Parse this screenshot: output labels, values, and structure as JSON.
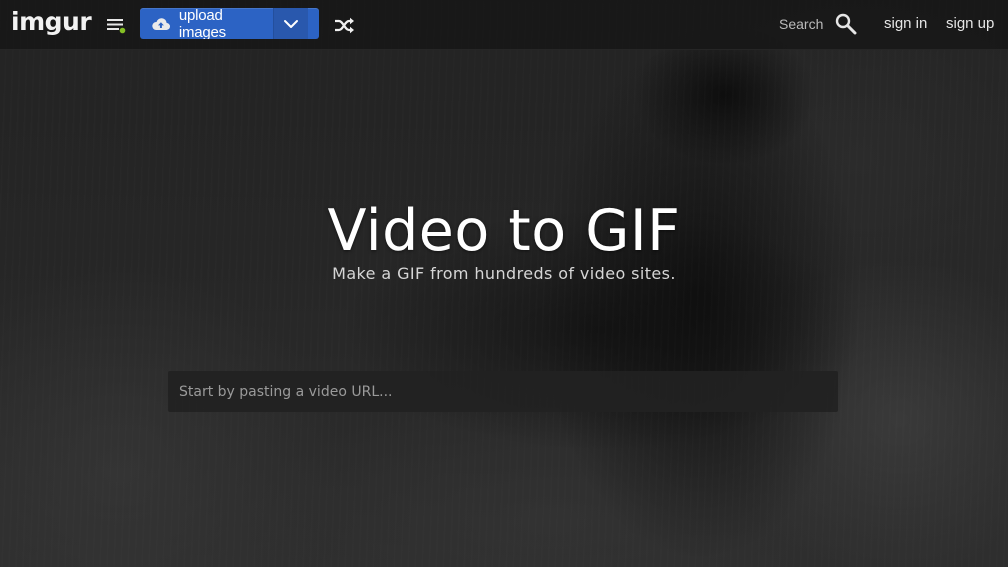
{
  "header": {
    "logo_text": "imgur",
    "upload_label": "upload images",
    "search_label": "Search",
    "sign_in": "sign in",
    "sign_up": "sign up"
  },
  "hero": {
    "title": "Video to GIF",
    "subtitle": "Make a GIF from hundreds of video sites.",
    "url_placeholder": "Start by pasting a video URL..."
  },
  "icons": {
    "menu": "menu-icon",
    "upload": "cloud-upload-icon",
    "dropdown": "chevron-down-icon",
    "shuffle": "shuffle-icon",
    "search": "search-icon"
  },
  "colors": {
    "upload_button": "#2c63c4",
    "menu_dot": "#85bf25",
    "topbar": "#181818"
  }
}
